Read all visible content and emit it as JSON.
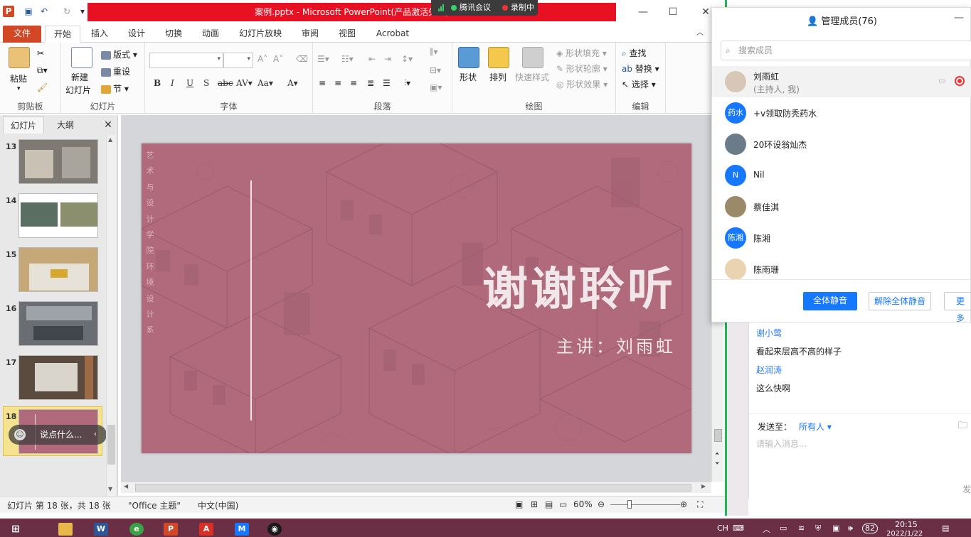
{
  "window": {
    "title": "案例.pptx - Microsoft PowerPoint(产品激活失败)",
    "meeting_app": "腾讯会议",
    "recording": "录制中"
  },
  "tabs": [
    "文件",
    "开始",
    "插入",
    "设计",
    "切换",
    "动画",
    "幻灯片放映",
    "审阅",
    "视图",
    "Acrobat"
  ],
  "active_tab": "开始",
  "ribbon": {
    "clipboard": {
      "label": "剪贴板",
      "paste": "粘贴"
    },
    "slides": {
      "label": "幻灯片",
      "new_slide_line1": "新建",
      "new_slide_line2": "幻灯片",
      "layout": "版式",
      "reset": "重设",
      "section": "节"
    },
    "font": {
      "label": "字体"
    },
    "paragraph": {
      "label": "段落"
    },
    "drawing": {
      "label": "绘图",
      "shape": "形状",
      "arrange": "排列",
      "quick_styles": "快速样式",
      "fill": "形状填充",
      "outline": "形状轮廓",
      "effects": "形状效果"
    },
    "editing": {
      "label": "编辑",
      "find": "查找",
      "replace": "替换",
      "select": "选择"
    }
  },
  "pane": {
    "tab_slides": "幻灯片",
    "tab_outline": "大纲",
    "thumbs": [
      "13",
      "14",
      "15",
      "16",
      "17",
      "18"
    ],
    "chat_pill": "说点什么..."
  },
  "slide": {
    "vertical_text": [
      "艺",
      "术",
      "与",
      "设",
      "计",
      "学",
      "院",
      "环",
      "境",
      "设",
      "计",
      "系"
    ],
    "title": "谢谢聆听",
    "speaker": "主讲：刘雨虹",
    "bg_color": "#b06a7c"
  },
  "status": {
    "slide_info": "幻灯片 第 18 张，共 18 张",
    "theme": "\"Office 主题\"",
    "language": "中文(中国)",
    "zoom": "60%"
  },
  "members": {
    "title": "管理成员(76)",
    "search_placeholder": "搜索成员",
    "list": [
      {
        "name": "刘雨虹",
        "sub": "(主持人, 我)",
        "avatar": ""
      },
      {
        "name": "+v领取防秃药水",
        "sub": "",
        "avatar": "药水"
      },
      {
        "name": "20环设翁灿杰",
        "sub": "",
        "avatar": ""
      },
      {
        "name": "Nil",
        "sub": "",
        "avatar": "N"
      },
      {
        "name": "蔡佳淇",
        "sub": "",
        "avatar": ""
      },
      {
        "name": "陈湘",
        "sub": "",
        "avatar": "陈湘"
      },
      {
        "name": "陈雨珊",
        "sub": "",
        "avatar": ""
      }
    ],
    "mute_all": "全体静音",
    "unmute_all": "解除全体静音",
    "more": "更多"
  },
  "chat": {
    "messages": [
      {
        "name": "谢小莺",
        "text": "看起来层高不高的样子"
      },
      {
        "name": "赵润涛",
        "text": "这么快啊"
      }
    ],
    "send_to_label": "发送至：",
    "send_to_value": "所有人",
    "input_placeholder": "请输入消息...",
    "send_label": "发"
  },
  "taskbar": {
    "ime": "CH",
    "battery": "82",
    "time": "20:15",
    "date": "2022/1/22"
  },
  "colors": {
    "ppt_red": "#d24726",
    "accent_blue": "#1677ff",
    "taskbar": "#6b2f45"
  }
}
